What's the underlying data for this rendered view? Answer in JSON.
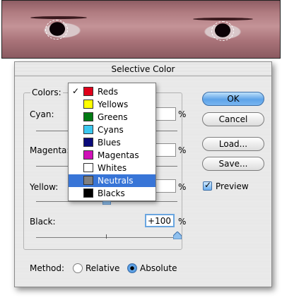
{
  "dialog": {
    "title": "Selective Color"
  },
  "colors_label": "Colors:",
  "sliders": [
    {
      "label": "Cyan:",
      "value": "",
      "unit": "%"
    },
    {
      "label": "Magenta:",
      "value": "",
      "unit": "%"
    },
    {
      "label": "Yellow:",
      "value": "",
      "unit": "%"
    },
    {
      "label": "Black:",
      "value": "+100",
      "unit": "%"
    }
  ],
  "menu": {
    "items": [
      {
        "label": "Reds",
        "color": "#e0001a",
        "checked": true
      },
      {
        "label": "Yellows",
        "color": "#ffff00"
      },
      {
        "label": "Greens",
        "color": "#007a12"
      },
      {
        "label": "Cyans",
        "color": "#3cc8f0"
      },
      {
        "label": "Blues",
        "color": "#0a0a7a"
      },
      {
        "label": "Magentas",
        "color": "#d010b8"
      },
      {
        "label": "Whites",
        "color": "#ffffff"
      },
      {
        "label": "Neutrals",
        "color": "#808080",
        "highlighted": true
      },
      {
        "label": "Blacks",
        "color": "#000000"
      }
    ],
    "check_glyph": "✓"
  },
  "buttons": {
    "ok": "OK",
    "cancel": "Cancel",
    "load": "Load...",
    "save": "Save..."
  },
  "preview": {
    "label": "Preview",
    "checked": true
  },
  "method": {
    "label": "Method:",
    "relative": "Relative",
    "absolute": "Absolute",
    "selected": "absolute"
  }
}
